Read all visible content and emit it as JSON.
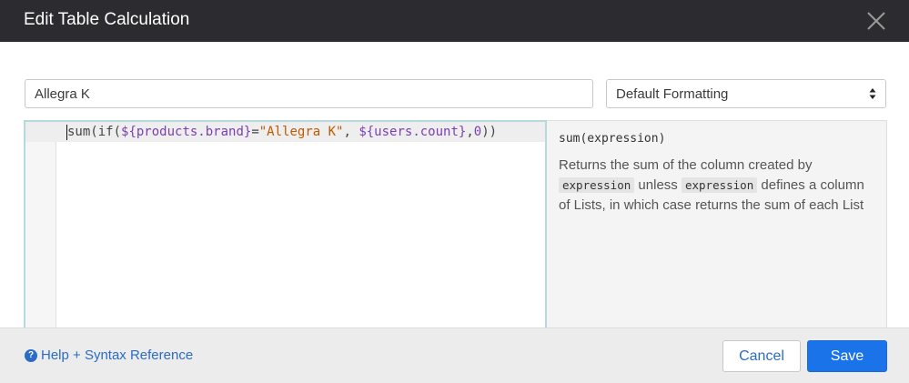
{
  "dialog": {
    "title": "Edit Table Calculation"
  },
  "form": {
    "name_value": "Allegra K",
    "format_value": "Default Formatting"
  },
  "editor": {
    "tokens": {
      "t1": "sum(if(",
      "t2": "${products.brand}",
      "t3": "=",
      "t4": "\"Allegra K\"",
      "t5": ", ",
      "t6": "${users.count}",
      "t7": ",",
      "t8": "0",
      "t9": "))"
    }
  },
  "help": {
    "signature": "sum(expression)",
    "desc": {
      "p1": "Returns the sum of the column created by ",
      "c1": "expression",
      "p2": " unless ",
      "c2": "expression",
      "p3": " defines a column of Lists, in which case returns the sum of each List"
    }
  },
  "footer": {
    "help_link": "Help + Syntax Reference",
    "cancel_label": "Cancel",
    "save_label": "Save"
  },
  "icons": {
    "close": "close-icon",
    "select_arrows": "select-arrows-icon",
    "help": "question-circle-icon"
  },
  "colors": {
    "header_bg": "#2c2c30",
    "primary": "#1a73e8",
    "link": "#2b6cc4"
  }
}
